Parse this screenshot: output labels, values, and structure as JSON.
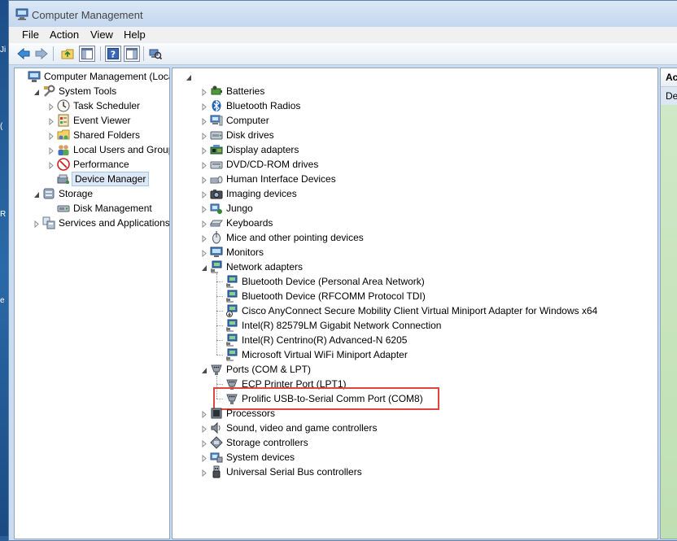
{
  "window": {
    "title": "Computer Management"
  },
  "menu": [
    "File",
    "Action",
    "View",
    "Help"
  ],
  "toolbar": {
    "buttons": [
      "back-arrow-icon",
      "forward-arrow-icon",
      "folder-up-icon",
      "show-hide-tree-icon",
      "help-icon",
      "show-hide-action-pane-icon",
      "scan-hardware-icon"
    ]
  },
  "left_tree": [
    {
      "label": "Computer Management (Local",
      "level": 0,
      "expander": "none",
      "icon": "computer-management-icon"
    },
    {
      "label": "System Tools",
      "level": 1,
      "expander": "expanded",
      "icon": "system-tools-icon"
    },
    {
      "label": "Task Scheduler",
      "level": 2,
      "expander": "collapsed",
      "icon": "clock-icon"
    },
    {
      "label": "Event Viewer",
      "level": 2,
      "expander": "collapsed",
      "icon": "event-viewer-icon"
    },
    {
      "label": "Shared Folders",
      "level": 2,
      "expander": "collapsed",
      "icon": "shared-folder-icon"
    },
    {
      "label": "Local Users and Groups",
      "level": 2,
      "expander": "collapsed",
      "icon": "users-icon"
    },
    {
      "label": "Performance",
      "level": 2,
      "expander": "collapsed",
      "icon": "performance-icon"
    },
    {
      "label": "Device Manager",
      "level": 2,
      "expander": "none",
      "icon": "device-manager-icon",
      "selected": true
    },
    {
      "label": "Storage",
      "level": 1,
      "expander": "expanded",
      "icon": "storage-icon"
    },
    {
      "label": "Disk Management",
      "level": 2,
      "expander": "none",
      "icon": "disk-management-icon"
    },
    {
      "label": "Services and Applications",
      "level": 1,
      "expander": "collapsed",
      "icon": "services-icon"
    }
  ],
  "device_tree": [
    {
      "label": "",
      "level": 0,
      "expander": "expanded",
      "icon": "none"
    },
    {
      "label": "Batteries",
      "level": 1,
      "expander": "collapsed",
      "icon": "battery-icon"
    },
    {
      "label": "Bluetooth Radios",
      "level": 1,
      "expander": "collapsed",
      "icon": "bluetooth-icon"
    },
    {
      "label": "Computer",
      "level": 1,
      "expander": "collapsed",
      "icon": "computer-icon"
    },
    {
      "label": "Disk drives",
      "level": 1,
      "expander": "collapsed",
      "icon": "disk-drive-icon"
    },
    {
      "label": "Display adapters",
      "level": 1,
      "expander": "collapsed",
      "icon": "display-adapter-icon"
    },
    {
      "label": "DVD/CD-ROM drives",
      "level": 1,
      "expander": "collapsed",
      "icon": "dvd-drive-icon"
    },
    {
      "label": "Human Interface Devices",
      "level": 1,
      "expander": "collapsed",
      "icon": "hid-icon"
    },
    {
      "label": "Imaging devices",
      "level": 1,
      "expander": "collapsed",
      "icon": "camera-icon"
    },
    {
      "label": "Jungo",
      "level": 1,
      "expander": "collapsed",
      "icon": "jungo-icon"
    },
    {
      "label": "Keyboards",
      "level": 1,
      "expander": "collapsed",
      "icon": "keyboard-icon"
    },
    {
      "label": "Mice and other pointing devices",
      "level": 1,
      "expander": "collapsed",
      "icon": "mouse-icon"
    },
    {
      "label": "Monitors",
      "level": 1,
      "expander": "collapsed",
      "icon": "monitor-icon"
    },
    {
      "label": "Network adapters",
      "level": 1,
      "expander": "expanded",
      "icon": "network-adapter-icon"
    },
    {
      "label": "Bluetooth Device (Personal Area Network)",
      "level": 2,
      "expander": "none",
      "icon": "network-adapter-icon"
    },
    {
      "label": "Bluetooth Device (RFCOMM Protocol TDI)",
      "level": 2,
      "expander": "none",
      "icon": "network-adapter-icon"
    },
    {
      "label": "Cisco AnyConnect Secure Mobility Client Virtual Miniport Adapter for Windows x64",
      "level": 2,
      "expander": "none",
      "icon": "network-adapter-disabled-icon"
    },
    {
      "label": "Intel(R) 82579LM Gigabit Network Connection",
      "level": 2,
      "expander": "none",
      "icon": "network-adapter-icon"
    },
    {
      "label": "Intel(R) Centrino(R) Advanced-N 6205",
      "level": 2,
      "expander": "none",
      "icon": "network-adapter-icon"
    },
    {
      "label": "Microsoft Virtual WiFi Miniport Adapter",
      "level": 2,
      "expander": "none",
      "icon": "network-adapter-icon"
    },
    {
      "label": "Ports (COM & LPT)",
      "level": 1,
      "expander": "expanded",
      "icon": "port-icon"
    },
    {
      "label": "ECP Printer Port (LPT1)",
      "level": 2,
      "expander": "none",
      "icon": "port-icon"
    },
    {
      "label": "Prolific USB-to-Serial Comm Port (COM8)",
      "level": 2,
      "expander": "none",
      "icon": "port-icon",
      "highlighted": true
    },
    {
      "label": "Processors",
      "level": 1,
      "expander": "collapsed",
      "icon": "processor-icon"
    },
    {
      "label": "Sound, video and game controllers",
      "level": 1,
      "expander": "collapsed",
      "icon": "speaker-icon"
    },
    {
      "label": "Storage controllers",
      "level": 1,
      "expander": "collapsed",
      "icon": "storage-controller-icon"
    },
    {
      "label": "System devices",
      "level": 1,
      "expander": "collapsed",
      "icon": "system-device-icon"
    },
    {
      "label": "Universal Serial Bus controllers",
      "level": 1,
      "expander": "collapsed",
      "icon": "usb-icon"
    }
  ],
  "actions": {
    "title": "Acti",
    "row": "De"
  },
  "colors": {
    "highlight_border": "#e0463b",
    "selection": "#dce8f5",
    "action_pane_green": "#c6e4bb"
  }
}
